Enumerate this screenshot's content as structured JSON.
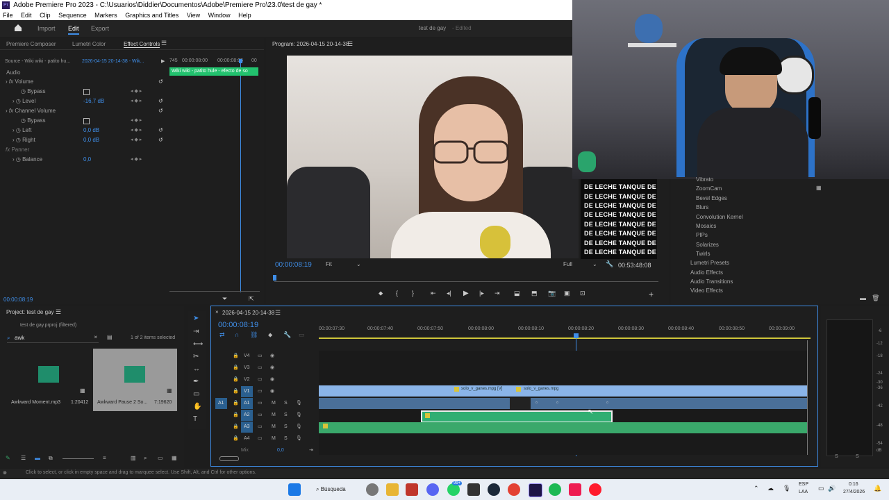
{
  "window": {
    "title": "Adobe Premiere Pro 2023 - C:\\Usuarios\\Diddier\\Documentos\\Adobe\\Premiere Pro\\23.0\\test de gay *",
    "app_icon": "Pr"
  },
  "menu": [
    "File",
    "Edit",
    "Clip",
    "Sequence",
    "Markers",
    "Graphics and Titles",
    "View",
    "Window",
    "Help"
  ],
  "workspace": {
    "tabs": [
      "Import",
      "Edit",
      "Export"
    ],
    "active": "Edit",
    "project_title": "test de gay",
    "edited_label": "- Edited"
  },
  "left_panel": {
    "tabs": [
      "Premiere Composer",
      "Lumetri Color",
      "Effect Controls"
    ],
    "source_label": "Source - Wiki wiki - patito hu...",
    "sequence_label": "2026-04-15 20-14-38 - Wik...",
    "timecodes": [
      "745",
      "00:00:08:00",
      "00:00:08:05",
      "00"
    ],
    "clip_label": "Wiki wiki - patito hule - efecto de so",
    "section": "Audio",
    "rows": [
      {
        "label": "Volume",
        "type": "fx"
      },
      {
        "label": "Bypass",
        "type": "check"
      },
      {
        "label": "Level",
        "value": "-16,7 dB"
      },
      {
        "label": "Channel Volume",
        "type": "fx"
      },
      {
        "label": "Bypass",
        "type": "check"
      },
      {
        "label": "Left",
        "value": "0,0 dB"
      },
      {
        "label": "Right",
        "value": "0,0 dB"
      },
      {
        "label": "Panner",
        "type": "fx"
      },
      {
        "label": "Balance",
        "value": "0,0"
      }
    ],
    "current_time": "00:00:08:19"
  },
  "program_monitor": {
    "title": "Program: 2026-04-15 20-14-38",
    "timecode": "00:00:08:19",
    "fit": "Fit",
    "quality": "Full",
    "duration": "00:53:48:08"
  },
  "overlay_lines": [
    "DE LECHE TANQUE DE",
    "DE LECHE TANQUE DE",
    "DE LECHE TANQUE DE",
    "DE LECHE TANQUE DE",
    "DE LECHE TANQUE DE",
    "DE LECHE TANQUE DE",
    "DE LECHE TANQUE DE",
    "DE LECHE TANQUE DE",
    "DE LECHE TANQUE DE"
  ],
  "effects": {
    "items": [
      "Vibrato",
      "ZoomCam",
      "Bevel Edges",
      "Blurs",
      "Convolution Kernel",
      "Mosaics",
      "PIPs",
      "Solarizes",
      "Twirls",
      "Lumetri Presets",
      "Audio Effects",
      "Audio Transitions",
      "Video Effects"
    ]
  },
  "project": {
    "title": "Project: test de gay",
    "file": "test de gay.prproj (filtered)",
    "search_value": "awk",
    "selection": "1 of 2 items selected",
    "items": [
      {
        "name": "Awkward Moment.mp3",
        "duration": "1:20412"
      },
      {
        "name": "Awkward Pause 2 So...",
        "duration": "7:19620"
      }
    ]
  },
  "timeline": {
    "sequence_name": "2026-04-15 20-14-38",
    "timecode": "00:00:08:19",
    "ruler": [
      "00:00:07:30",
      "00:00:07:40",
      "00:00:07:50",
      "00:00:08:00",
      "00:00:08:10",
      "00:00:08:20",
      "00:00:08:30",
      "00:00:08:40",
      "00:00:08:50",
      "00:00:09:00"
    ],
    "tracks": [
      "V4",
      "V3",
      "V2",
      "V1",
      "A1",
      "A2",
      "A3",
      "A4"
    ],
    "mix_label": "Mix",
    "mix_value": "0,0",
    "clip1": "solo_v_ganes.mpg [V]",
    "clip2": "solo_v_ganes.mpg"
  },
  "meters": {
    "labels": [
      "-6",
      "-12",
      "-18",
      "-24",
      "-30",
      "-36",
      "-42",
      "-48",
      "-54",
      "dB"
    ],
    "solo": [
      "S",
      "S"
    ]
  },
  "status": "Click to select, or click in empty space and drag to marquee select. Use Shift, Alt, and Ctrl for other options.",
  "taskbar": {
    "search": "Búsqueda",
    "lang": "ESP",
    "region": "LAA",
    "time": "0:16",
    "date": "27/4/2026",
    "badge": "99+"
  }
}
